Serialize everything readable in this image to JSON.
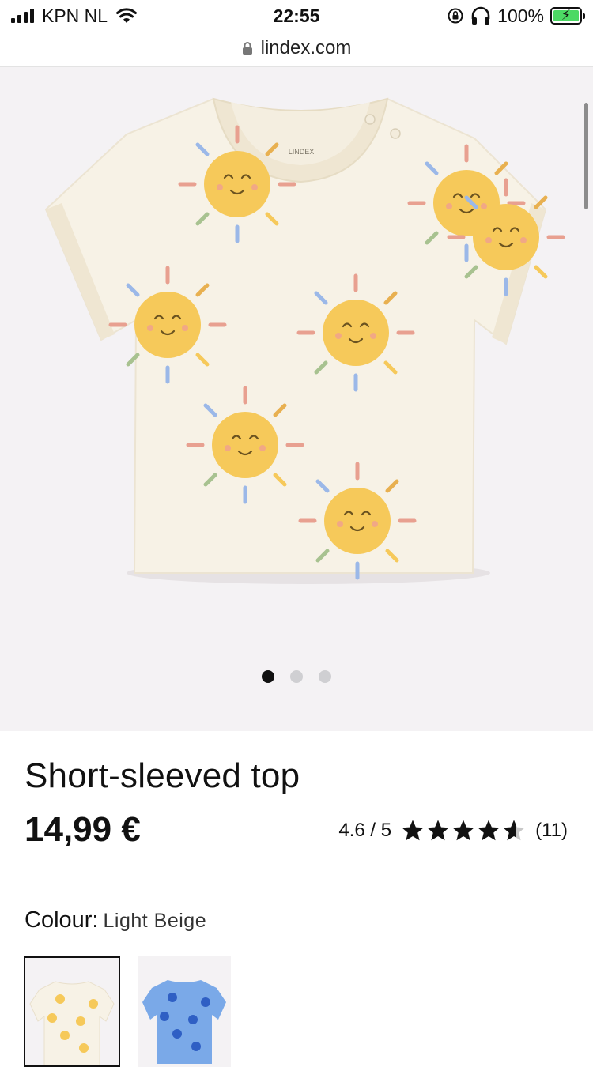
{
  "status_bar": {
    "carrier": "KPN NL",
    "time": "22:55",
    "battery_percent": "100%"
  },
  "browser": {
    "url": "lindex.com"
  },
  "gallery": {
    "image_count": 3,
    "active_index": 0,
    "label_print_brand": "LINDEX"
  },
  "product": {
    "title": "Short-sleeved top",
    "price": "14,99 €",
    "rating_text": "4.6 / 5",
    "rating_value": 4.6,
    "rating_max": 5,
    "review_count": "(11)"
  },
  "colour": {
    "label": "Colour:",
    "selected": "Light Beige",
    "options": [
      "Light Beige",
      "Blue"
    ]
  },
  "colors": {
    "shirt": "#f7f2e6",
    "sun": "#f6c95a",
    "swatch_blue": "#7aa9e8",
    "text": "#111111"
  }
}
